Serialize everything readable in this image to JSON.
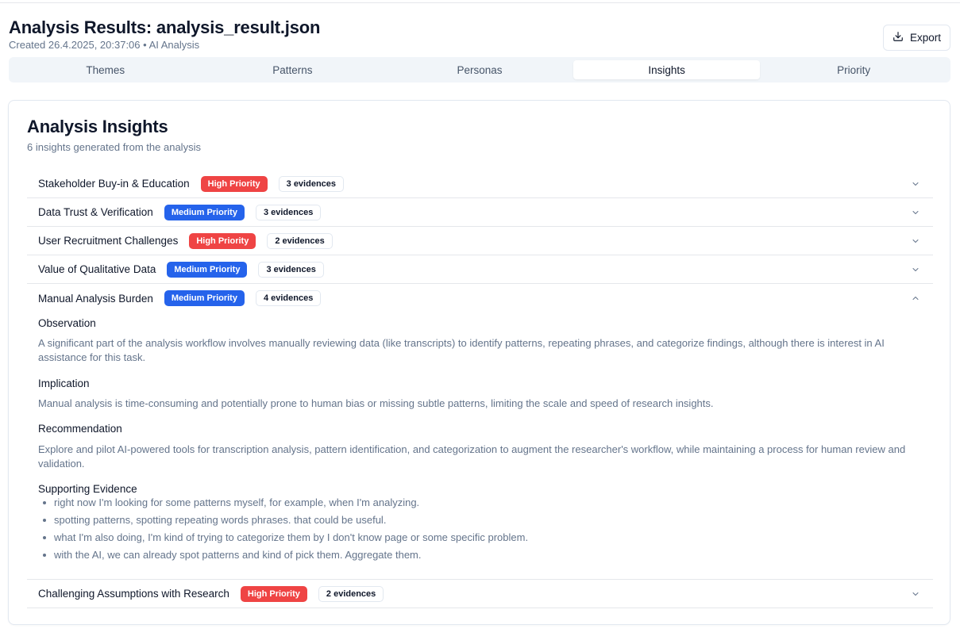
{
  "header": {
    "title": "Analysis Results: analysis_result.json",
    "subtitle": "Created 26.4.2025, 20:37:06 • AI Analysis",
    "export_label": "Export"
  },
  "tabs": [
    {
      "label": "Themes",
      "active": false
    },
    {
      "label": "Patterns",
      "active": false
    },
    {
      "label": "Personas",
      "active": false
    },
    {
      "label": "Insights",
      "active": true
    },
    {
      "label": "Priority",
      "active": false
    }
  ],
  "card": {
    "title": "Analysis Insights",
    "subtitle": "6 insights generated from the analysis"
  },
  "insights": [
    {
      "title": "Stakeholder Buy-in & Education",
      "priority": "High Priority",
      "evidence": "3 evidences"
    },
    {
      "title": "Data Trust & Verification",
      "priority": "Medium Priority",
      "evidence": "3 evidences"
    },
    {
      "title": "User Recruitment Challenges",
      "priority": "High Priority",
      "evidence": "2 evidences"
    },
    {
      "title": "Value of Qualitative Data",
      "priority": "Medium Priority",
      "evidence": "3 evidences"
    },
    {
      "title": "Manual Analysis Burden",
      "priority": "Medium Priority",
      "evidence": "4 evidences",
      "expanded": true,
      "observation_label": "Observation",
      "observation": "A significant part of the analysis workflow involves manually reviewing data (like transcripts) to identify patterns, repeating phrases, and categorize findings, although there is interest in AI assistance for this task.",
      "implication_label": "Implication",
      "implication": "Manual analysis is time-consuming and potentially prone to human bias or missing subtle patterns, limiting the scale and speed of research insights.",
      "recommendation_label": "Recommendation",
      "recommendation": "Explore and pilot AI-powered tools for transcription analysis, pattern identification, and categorization to augment the researcher's workflow, while maintaining a process for human review and validation.",
      "supporting_label": "Supporting Evidence",
      "supporting": [
        "right now I'm looking for some patterns myself, for example, when I'm analyzing.",
        "spotting patterns, spotting repeating words phrases. that could be useful.",
        "what I'm also doing, I'm kind of trying to categorize them by I don't know page or some specific problem.",
        "with the AI, we can already spot patterns and kind of pick them. Aggregate them."
      ]
    },
    {
      "title": "Challenging Assumptions with Research",
      "priority": "High Priority",
      "evidence": "2 evidences"
    }
  ],
  "colors": {
    "high_priority": "#ef4444",
    "medium_priority": "#2563eb",
    "muted_text": "#64748b",
    "border": "#e2e8f0"
  },
  "icons": {
    "export": "download-icon",
    "collapsed": "chevron-down-icon",
    "expanded": "chevron-up-icon"
  }
}
